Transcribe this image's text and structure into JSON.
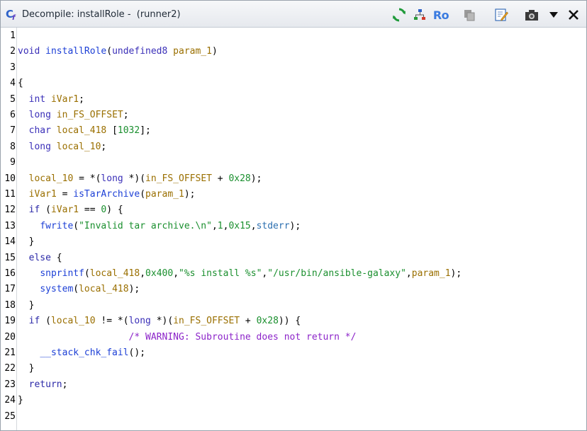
{
  "window": {
    "title": "Decompile: installRole -  (runner2)"
  },
  "toolbar": {
    "ro_label": "Ro"
  },
  "lines": [
    {
      "n": "1",
      "tokens": []
    },
    {
      "n": "2",
      "tokens": [
        {
          "t": "type",
          "v": "void"
        },
        {
          "t": "pun",
          "v": " "
        },
        {
          "t": "func",
          "v": "installRole"
        },
        {
          "t": "pun",
          "v": "("
        },
        {
          "t": "type",
          "v": "undefined8"
        },
        {
          "t": "pun",
          "v": " "
        },
        {
          "t": "param",
          "v": "param_1"
        },
        {
          "t": "pun",
          "v": ")"
        }
      ]
    },
    {
      "n": "3",
      "tokens": []
    },
    {
      "n": "4",
      "tokens": [
        {
          "t": "pun",
          "v": "{"
        }
      ]
    },
    {
      "n": "5",
      "tokens": [
        {
          "t": "pun",
          "v": "  "
        },
        {
          "t": "type",
          "v": "int"
        },
        {
          "t": "pun",
          "v": " "
        },
        {
          "t": "var",
          "v": "iVar1"
        },
        {
          "t": "pun",
          "v": ";"
        }
      ]
    },
    {
      "n": "6",
      "tokens": [
        {
          "t": "pun",
          "v": "  "
        },
        {
          "t": "type",
          "v": "long"
        },
        {
          "t": "pun",
          "v": " "
        },
        {
          "t": "var",
          "v": "in_FS_OFFSET"
        },
        {
          "t": "pun",
          "v": ";"
        }
      ]
    },
    {
      "n": "7",
      "tokens": [
        {
          "t": "pun",
          "v": "  "
        },
        {
          "t": "type",
          "v": "char"
        },
        {
          "t": "pun",
          "v": " "
        },
        {
          "t": "var",
          "v": "local_418"
        },
        {
          "t": "pun",
          "v": " ["
        },
        {
          "t": "num",
          "v": "1032"
        },
        {
          "t": "pun",
          "v": "];"
        }
      ]
    },
    {
      "n": "8",
      "tokens": [
        {
          "t": "pun",
          "v": "  "
        },
        {
          "t": "type",
          "v": "long"
        },
        {
          "t": "pun",
          "v": " "
        },
        {
          "t": "var",
          "v": "local_10"
        },
        {
          "t": "pun",
          "v": ";"
        }
      ]
    },
    {
      "n": "9",
      "tokens": []
    },
    {
      "n": "10",
      "tokens": [
        {
          "t": "pun",
          "v": "  "
        },
        {
          "t": "var",
          "v": "local_10"
        },
        {
          "t": "pun",
          "v": " = *("
        },
        {
          "t": "type",
          "v": "long"
        },
        {
          "t": "pun",
          "v": " *)("
        },
        {
          "t": "var",
          "v": "in_FS_OFFSET"
        },
        {
          "t": "pun",
          "v": " + "
        },
        {
          "t": "num",
          "v": "0x28"
        },
        {
          "t": "pun",
          "v": ");"
        }
      ]
    },
    {
      "n": "11",
      "tokens": [
        {
          "t": "pun",
          "v": "  "
        },
        {
          "t": "var",
          "v": "iVar1"
        },
        {
          "t": "pun",
          "v": " = "
        },
        {
          "t": "func",
          "v": "isTarArchive"
        },
        {
          "t": "pun",
          "v": "("
        },
        {
          "t": "param",
          "v": "param_1"
        },
        {
          "t": "pun",
          "v": ");"
        }
      ]
    },
    {
      "n": "12",
      "tokens": [
        {
          "t": "pun",
          "v": "  "
        },
        {
          "t": "kw",
          "v": "if"
        },
        {
          "t": "pun",
          "v": " ("
        },
        {
          "t": "var",
          "v": "iVar1"
        },
        {
          "t": "pun",
          "v": " == "
        },
        {
          "t": "num",
          "v": "0"
        },
        {
          "t": "pun",
          "v": ") {"
        }
      ]
    },
    {
      "n": "13",
      "tokens": [
        {
          "t": "pun",
          "v": "    "
        },
        {
          "t": "func",
          "v": "fwrite"
        },
        {
          "t": "pun",
          "v": "("
        },
        {
          "t": "str",
          "v": "\"Invalid tar archive.\\n\""
        },
        {
          "t": "pun",
          "v": ","
        },
        {
          "t": "num",
          "v": "1"
        },
        {
          "t": "pun",
          "v": ","
        },
        {
          "t": "num",
          "v": "0x15"
        },
        {
          "t": "pun",
          "v": ","
        },
        {
          "t": "glob",
          "v": "stderr"
        },
        {
          "t": "pun",
          "v": ");"
        }
      ]
    },
    {
      "n": "14",
      "tokens": [
        {
          "t": "pun",
          "v": "  }"
        }
      ]
    },
    {
      "n": "15",
      "tokens": [
        {
          "t": "pun",
          "v": "  "
        },
        {
          "t": "kw",
          "v": "else"
        },
        {
          "t": "pun",
          "v": " {"
        }
      ]
    },
    {
      "n": "16",
      "tokens": [
        {
          "t": "pun",
          "v": "    "
        },
        {
          "t": "func",
          "v": "snprintf"
        },
        {
          "t": "pun",
          "v": "("
        },
        {
          "t": "var",
          "v": "local_418"
        },
        {
          "t": "pun",
          "v": ","
        },
        {
          "t": "num",
          "v": "0x400"
        },
        {
          "t": "pun",
          "v": ","
        },
        {
          "t": "str",
          "v": "\"%s install %s\""
        },
        {
          "t": "pun",
          "v": ","
        },
        {
          "t": "str",
          "v": "\"/usr/bin/ansible-galaxy\""
        },
        {
          "t": "pun",
          "v": ","
        },
        {
          "t": "param",
          "v": "param_1"
        },
        {
          "t": "pun",
          "v": ");"
        }
      ]
    },
    {
      "n": "17",
      "tokens": [
        {
          "t": "pun",
          "v": "    "
        },
        {
          "t": "func",
          "v": "system"
        },
        {
          "t": "pun",
          "v": "("
        },
        {
          "t": "var",
          "v": "local_418"
        },
        {
          "t": "pun",
          "v": ");"
        }
      ]
    },
    {
      "n": "18",
      "tokens": [
        {
          "t": "pun",
          "v": "  }"
        }
      ]
    },
    {
      "n": "19",
      "tokens": [
        {
          "t": "pun",
          "v": "  "
        },
        {
          "t": "kw",
          "v": "if"
        },
        {
          "t": "pun",
          "v": " ("
        },
        {
          "t": "var",
          "v": "local_10"
        },
        {
          "t": "pun",
          "v": " != *("
        },
        {
          "t": "type",
          "v": "long"
        },
        {
          "t": "pun",
          "v": " *)("
        },
        {
          "t": "var",
          "v": "in_FS_OFFSET"
        },
        {
          "t": "pun",
          "v": " + "
        },
        {
          "t": "num",
          "v": "0x28"
        },
        {
          "t": "pun",
          "v": ")) {"
        }
      ]
    },
    {
      "n": "20",
      "tokens": [
        {
          "t": "pun",
          "v": "                    "
        },
        {
          "t": "cmt",
          "v": "/* WARNING: Subroutine does not return */"
        }
      ]
    },
    {
      "n": "21",
      "tokens": [
        {
          "t": "pun",
          "v": "    "
        },
        {
          "t": "func",
          "v": "__stack_chk_fail"
        },
        {
          "t": "pun",
          "v": "();"
        }
      ]
    },
    {
      "n": "22",
      "tokens": [
        {
          "t": "pun",
          "v": "  }"
        }
      ]
    },
    {
      "n": "23",
      "tokens": [
        {
          "t": "pun",
          "v": "  "
        },
        {
          "t": "kw",
          "v": "return"
        },
        {
          "t": "pun",
          "v": ";"
        }
      ]
    },
    {
      "n": "24",
      "tokens": [
        {
          "t": "pun",
          "v": "}"
        }
      ]
    },
    {
      "n": "25",
      "tokens": []
    }
  ]
}
